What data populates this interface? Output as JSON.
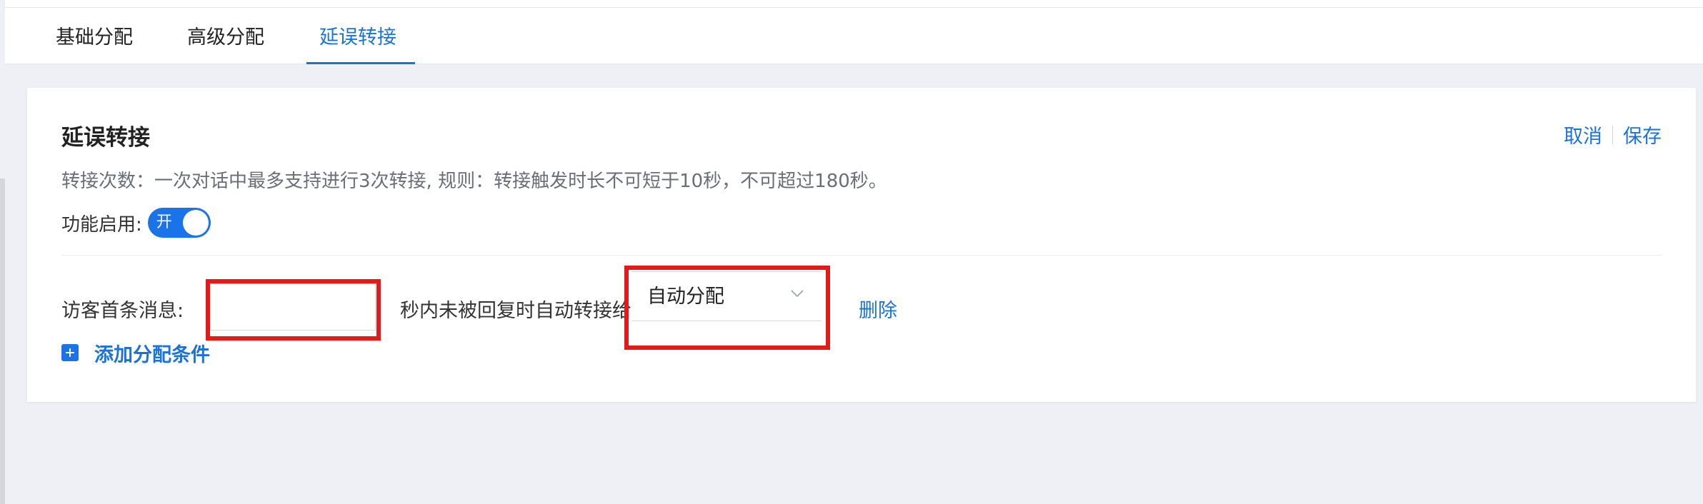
{
  "tabs": [
    {
      "label": "基础分配"
    },
    {
      "label": "高级分配"
    },
    {
      "label": "延误转接"
    }
  ],
  "active_tab": "延误转接",
  "card": {
    "title": "延误转接",
    "actions": {
      "cancel": "取消",
      "save": "保存"
    },
    "description": "转接次数：一次对话中最多支持进行3次转接, 规则：转接触发时长不可短于10秒，不可超过180秒。",
    "enable": {
      "label": "功能启用:",
      "toggle_text": "开",
      "state": "on"
    },
    "rule": {
      "label": "访客首条消息:",
      "seconds_value": "",
      "text": "秒内未被回复时自动转接给",
      "select_value": "自动分配",
      "delete_label": "删除"
    },
    "add_condition": "添加分配条件"
  },
  "colors": {
    "accent": "#1a73d9",
    "highlight": "#e21a1a",
    "background": "#eef0f5"
  },
  "icons": {
    "dropdown": "chevron-down-icon",
    "add": "plus-square-icon"
  }
}
